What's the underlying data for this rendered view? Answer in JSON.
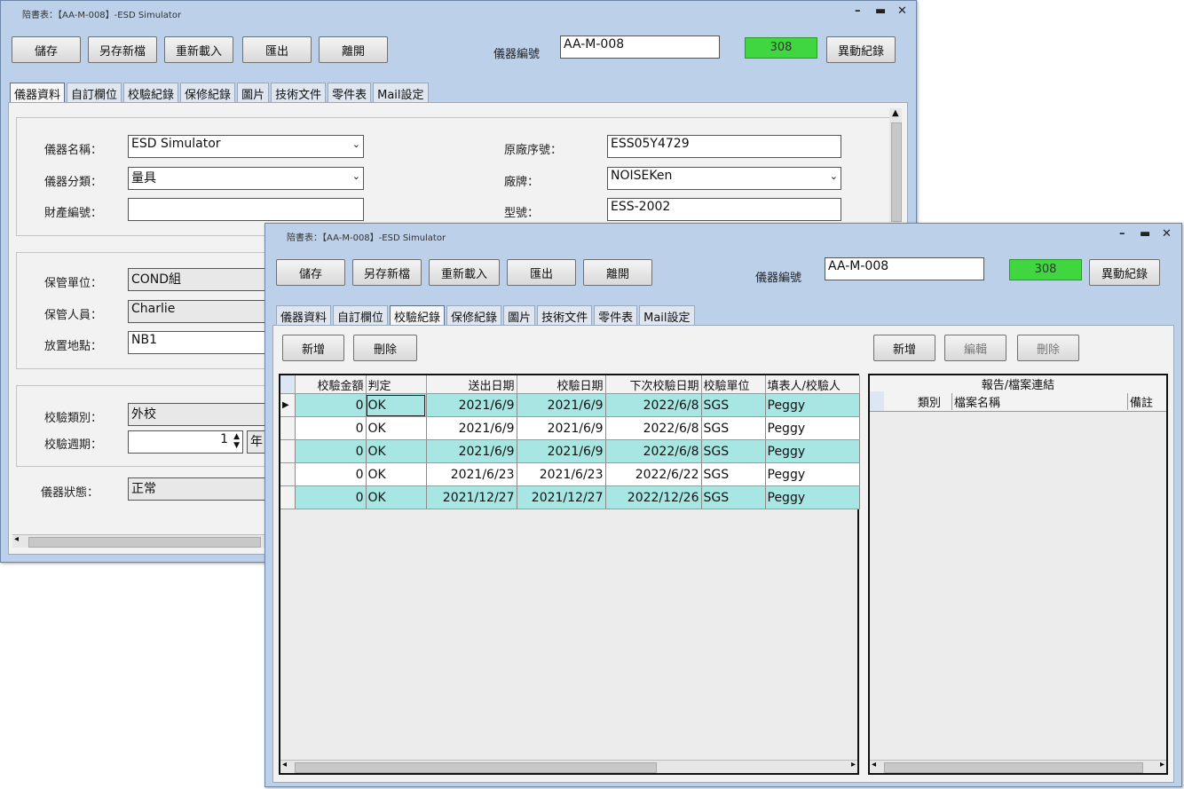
{
  "back_window": {
    "title": "陪書表：【AA-M-008】-ESD Simulator",
    "toolbar": [
      "儲存",
      "另存新檔",
      "重新載入",
      "匯出",
      "離開"
    ],
    "instrument_no_label": "儀器編號",
    "instrument_no": "AA-M-008",
    "counter": "308",
    "history_button": "異動紀錄",
    "tabs": [
      "儀器資料",
      "自訂欄位",
      "校驗紀錄",
      "保修紀錄",
      "圖片",
      "技術文件",
      "零件表",
      "Mail設定"
    ],
    "fields": {
      "name_label": "儀器名稱：",
      "name": "ESD Simulator",
      "category_label": "儀器分類：",
      "category": "量具",
      "asset_label": "財產編號：",
      "asset": "",
      "serial_label": "原廠序號：",
      "serial": "ESS05Y4729",
      "brand_label": "廠牌：",
      "brand": "NOISEKen",
      "model_label": "型號：",
      "model": "ESS-2002",
      "unit_label": "保管單位：",
      "unit": "COND組",
      "person_label": "保管人員：",
      "person": "Charlie",
      "location_label": "放置地點：",
      "location": "NB1",
      "cal_type_label": "校驗類別：",
      "cal_type": "外校",
      "cal_period_label": "校驗週期：",
      "cal_period": "1",
      "cal_period_unit": "年",
      "status_label": "儀器狀態：",
      "status": "正常"
    }
  },
  "front_window": {
    "title": "陪書表：【AA-M-008】-ESD Simulator",
    "toolbar": [
      "儲存",
      "另存新檔",
      "重新載入",
      "匯出",
      "離開"
    ],
    "instrument_no_label": "儀器編號",
    "instrument_no": "AA-M-008",
    "counter": "308",
    "history_button": "異動紀錄",
    "tabs": [
      "儀器資料",
      "自訂欄位",
      "校驗紀錄",
      "保修紀錄",
      "圖片",
      "技術文件",
      "零件表",
      "Mail設定"
    ],
    "left_buttons": [
      "新增",
      "刪除"
    ],
    "right_buttons": [
      "新增",
      "編輯",
      "刪除"
    ],
    "grid_headers": [
      "校驗金額",
      "判定",
      "送出日期",
      "校驗日期",
      "下次校驗日期",
      "校驗單位",
      "填表人/校驗人"
    ],
    "grid_rows": [
      [
        "0",
        "OK",
        "2021/6/9",
        "2021/6/9",
        "2022/6/8",
        "SGS",
        "Peggy"
      ],
      [
        "0",
        "OK",
        "2021/6/9",
        "2021/6/9",
        "2022/6/8",
        "SGS",
        "Peggy"
      ],
      [
        "0",
        "OK",
        "2021/6/9",
        "2021/6/9",
        "2022/6/8",
        "SGS",
        "Peggy"
      ],
      [
        "0",
        "OK",
        "2021/6/23",
        "2021/6/23",
        "2022/6/22",
        "SGS",
        "Peggy"
      ],
      [
        "0",
        "OK",
        "2021/12/27",
        "2021/12/27",
        "2022/12/26",
        "SGS",
        "Peggy"
      ]
    ],
    "report_title": "報告/檔案連結",
    "report_headers": [
      "類別",
      "檔案名稱",
      "備註"
    ]
  },
  "colors": {
    "counter_green": "#3fd63f",
    "row_highlight": "#a7e6e2",
    "window_frame": "#bcd0ea"
  }
}
